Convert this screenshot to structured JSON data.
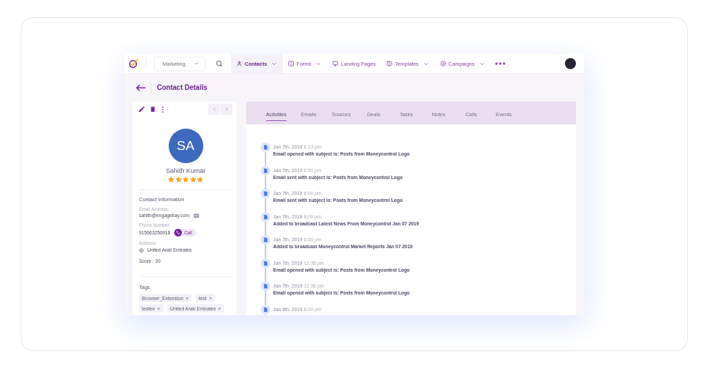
{
  "nav": {
    "workspace": {
      "value": "Marketing"
    },
    "items": [
      {
        "label": "Contacts",
        "selected": true,
        "dropdown": true
      },
      {
        "label": "Forms",
        "selected": false,
        "dropdown": true
      },
      {
        "label": "Landing Pages",
        "selected": false,
        "dropdown": false
      },
      {
        "label": "Templates",
        "selected": false,
        "dropdown": true
      },
      {
        "label": "Campaigns",
        "selected": false,
        "dropdown": true
      }
    ]
  },
  "page_title": "Contact Details",
  "contact": {
    "initials": "SA",
    "name": "Sahith Kumar",
    "stars": 5,
    "section_title": "Contact Information",
    "fields": [
      {
        "kind": "email",
        "label": "Email Address:",
        "value": "sahith@engagebay.com"
      },
      {
        "kind": "phone",
        "label": "Phone Number:",
        "value": "915663256918",
        "action": "Call"
      },
      {
        "kind": "address",
        "label": "Address:",
        "value": "United Arab Emirates"
      }
    ],
    "score": "Score : 20",
    "tags_title": "Tags",
    "tags": [
      "Browser_Extension",
      "test",
      "testee",
      "United Arab Emirates"
    ]
  },
  "tabs": [
    {
      "label": "Activities",
      "selected": true
    },
    {
      "label": "Emails",
      "selected": false
    },
    {
      "label": "Sources",
      "selected": false
    },
    {
      "label": "Deals",
      "selected": false
    },
    {
      "label": "Tasks",
      "selected": false
    },
    {
      "label": "Notes",
      "selected": false
    },
    {
      "label": "Calls",
      "selected": false
    },
    {
      "label": "Events",
      "selected": false
    }
  ],
  "activities": [
    {
      "date": "Jan 7th, 2019",
      "time": "6:13 pm",
      "text": "Email opened with subject is: Posts from Moneycontrol Logo"
    },
    {
      "date": "Jan 7th, 2019",
      "time": "6:00 pm",
      "text": "Email sent with subject is: Posts from Moneycontrol Logo"
    },
    {
      "date": "Jan 7th, 2019",
      "time": "6:00 pm",
      "text": "Email sent with subject is: Posts from Moneycontrol Logo"
    },
    {
      "date": "Jan 7th, 2019",
      "time": "6:00 pm",
      "text": "Added to broadcast Latest News From Moneycontrol Jan 07 2019"
    },
    {
      "date": "Jan 7th, 2019",
      "time": "6:00 pm",
      "text": "Added to broadcast Moneycontrol Market Reports Jan 07 2019"
    },
    {
      "date": "Jan 7th, 2019",
      "time": "12:38 pm",
      "text": "Email opened with subject is: Posts from Moneycontrol Logo"
    },
    {
      "date": "Jan 7th, 2019",
      "time": "12:38 pm",
      "text": "Email opened with subject is: Posts from Moneycontrol Logo"
    },
    {
      "date": "Jan 6th, 2019",
      "time": "6:00 pm"
    }
  ]
}
